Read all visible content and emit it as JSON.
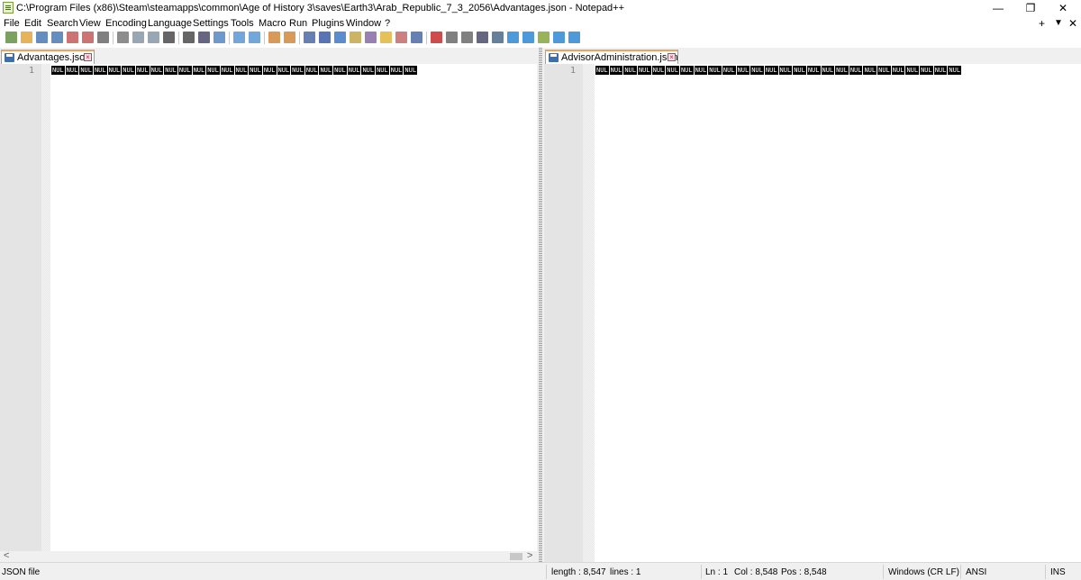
{
  "window": {
    "title": "C:\\Program Files (x86)\\Steam\\steamapps\\common\\Age of History 3\\saves\\Earth3\\Arab_Republic_7_3_2056\\Advantages.json - Notepad++",
    "minimize": "—",
    "maximize": "❐",
    "close": "✕"
  },
  "menu": {
    "items": [
      "File",
      "Edit",
      "Search",
      "View",
      "Encoding",
      "Language",
      "Settings",
      "Tools",
      "Macro",
      "Run",
      "Plugins",
      "Window",
      "?"
    ],
    "right": [
      "+",
      "▼",
      "✕"
    ]
  },
  "toolbar": {
    "icons": [
      "new-file-icon",
      "open-file-icon",
      "save-icon",
      "save-all-icon",
      "close-icon",
      "close-all-icon",
      "print-icon",
      "cut-icon",
      "copy-icon",
      "paste-icon",
      "undo-icon",
      "redo-icon",
      "find-icon",
      "replace-icon",
      "zoom-in-icon",
      "zoom-out-icon",
      "sync-vertical-icon",
      "sync-horizontal-icon",
      "word-wrap-icon",
      "show-all-chars-icon",
      "indent-guide-icon",
      "doc-map-icon",
      "function-list-icon",
      "folder-workspace-icon",
      "doc-list-icon",
      "monitoring-icon",
      "record-macro-icon",
      "stop-macro-icon",
      "play-macro-icon",
      "run-macro-multiple-icon",
      "save-macro-icon",
      "up-arrow-icon",
      "left-arrow-icon",
      "bookmark-icon",
      "right-arrow-icon",
      "down-arrow-icon"
    ]
  },
  "left_pane": {
    "tab_label": "Advantages.json",
    "line_number": "1",
    "nul_token": "NUL",
    "scroll_left": "<",
    "scroll_right": ">"
  },
  "right_pane": {
    "tab_label": "AdvisorAdministration.json",
    "line_number": "1",
    "nul_token": "NUL"
  },
  "status": {
    "file_type": "JSON file",
    "length": "length : 8,547",
    "lines": "lines : 1",
    "ln": "Ln : 1",
    "col": "Col : 8,548",
    "pos": "Pos : 8,548",
    "eol": "Windows (CR LF)",
    "encoding": "ANSI",
    "mode": "INS"
  },
  "colors": {
    "accent_tab": "#f0a060",
    "nul_bg": "#000000",
    "nul_fg": "#ffffff"
  }
}
